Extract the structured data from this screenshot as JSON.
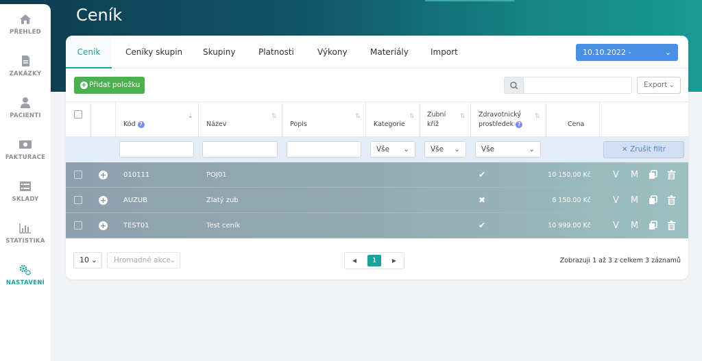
{
  "page_title": "Ceník",
  "sidebar": {
    "items": [
      {
        "label": "PŘEHLED",
        "icon": "home-icon"
      },
      {
        "label": "ZAKÁZKY",
        "icon": "document-icon"
      },
      {
        "label": "PACIENTI",
        "icon": "user-icon"
      },
      {
        "label": "FAKTURACE",
        "icon": "money-icon"
      },
      {
        "label": "SKLADY",
        "icon": "list-icon"
      },
      {
        "label": "STATISTIKA",
        "icon": "bar-chart-icon"
      },
      {
        "label": "NASTAVENÍ",
        "icon": "gears-icon",
        "active": true
      }
    ]
  },
  "tabs": [
    {
      "label": "Ceník",
      "active": true
    },
    {
      "label": "Ceníky skupin"
    },
    {
      "label": "Skupiny"
    },
    {
      "label": "Platnosti"
    },
    {
      "label": "Výkony"
    },
    {
      "label": "Materiály"
    },
    {
      "label": "Import"
    }
  ],
  "date_select": {
    "value": "10.10.2022 -"
  },
  "toolbar": {
    "add_label": "Přidat položku",
    "search_value": "",
    "export_label": "Export"
  },
  "columns": {
    "kod": "Kód",
    "nazev": "Název",
    "popis": "Popis",
    "kategorie": "Kategorie",
    "zubni_kriz_1": "Zubní",
    "zubni_kriz_2": "kříž",
    "zdrav_1": "Zdravotnický",
    "zdrav_2": "prostředek",
    "cena": "Cena"
  },
  "filters": {
    "kategorie": "Vše",
    "zubni_kriz": "Vše",
    "zdravotnicky": "Vše",
    "clear_label": "Zrušit filtr"
  },
  "rows": [
    {
      "kod": "010111",
      "nazev": "POJ01",
      "mark": "✔",
      "cena": "10 150.00 Kč"
    },
    {
      "kod": "AUZUB",
      "nazev": "Zlatý zub",
      "mark": "✖",
      "cena": "6 150.00 Kč"
    },
    {
      "kod": "TEST01",
      "nazev": "Test ceník",
      "mark": "✔",
      "cena": "10 999.00 Kč"
    }
  ],
  "row_actions": {
    "v": "V",
    "m": "M"
  },
  "footer": {
    "per_page": "10",
    "bulk_placeholder": "Hromadné akce",
    "current_page": "1",
    "info": "Zobrazuji 1 až 3 z celkem 3 záznamů"
  },
  "colors": {
    "accent": "#1aa39c",
    "primary": "#4a90e2",
    "success": "#4caf50"
  }
}
